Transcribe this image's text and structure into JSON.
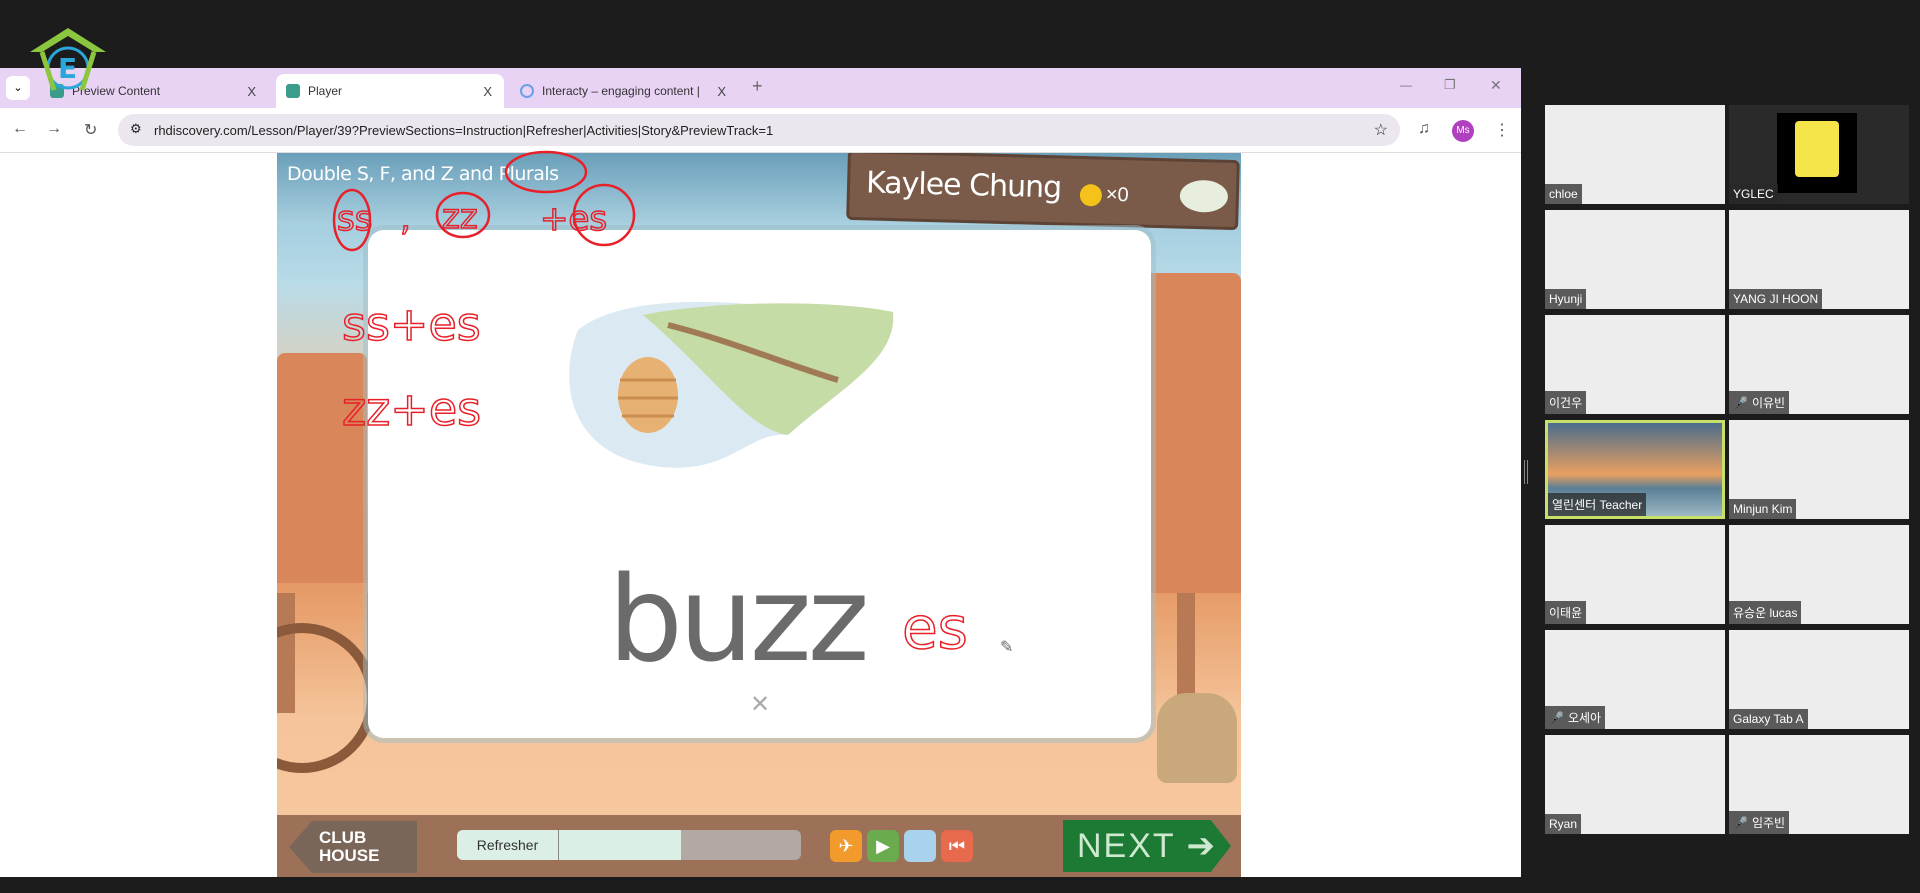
{
  "browser": {
    "tabs": [
      {
        "label": "Preview Content",
        "close": "X"
      },
      {
        "label": "Player",
        "close": "X",
        "active": true
      },
      {
        "label": "Interacty – engaging content |",
        "close": "X"
      }
    ],
    "new_tab": "+",
    "url": "rhdiscovery.com/Lesson/Player/39?PreviewSections=Instruction|Refresher|Activities|Story&PreviewTrack=1",
    "profile": "Ms",
    "window_controls": [
      "—",
      "❐",
      "✕"
    ]
  },
  "lesson": {
    "title": "Double S, F, and Z and Plurals",
    "student_name": "Kaylee Chung",
    "coin_count": "×0",
    "word": "buzz",
    "close": "✕",
    "clubhouse": "CLUB HOUSE",
    "progress_label": "Refresher",
    "progress_fraction": 0.65,
    "next": "NEXT ➔"
  },
  "annotations": {
    "line1a": "ss",
    "line1b": ",",
    "line1c": "zz",
    "line1d": "+es",
    "line2": "ss+es",
    "line3": "zz+es",
    "after_word": "es"
  },
  "participants": [
    {
      "name": "chloe"
    },
    {
      "name": "YGLEC"
    },
    {
      "name": "Hyunji"
    },
    {
      "name": "YANG JI HOON"
    },
    {
      "name": "이건우"
    },
    {
      "name": "이유빈",
      "muted": true
    },
    {
      "name": "열린센터 Teacher",
      "active_speaker": true
    },
    {
      "name": "Minjun Kim"
    },
    {
      "name": "이태윤"
    },
    {
      "name": "유승운 lucas"
    },
    {
      "name": "오세아",
      "muted": true
    },
    {
      "name": "Galaxy Tab A"
    },
    {
      "name": "Ryan"
    },
    {
      "name": "임주빈",
      "muted": true
    }
  ],
  "colors": {
    "tabbar": "#e8d3f5",
    "annotation": "#e8202a",
    "next": "#1d7a35",
    "speaker_border": "#c8e06a"
  }
}
